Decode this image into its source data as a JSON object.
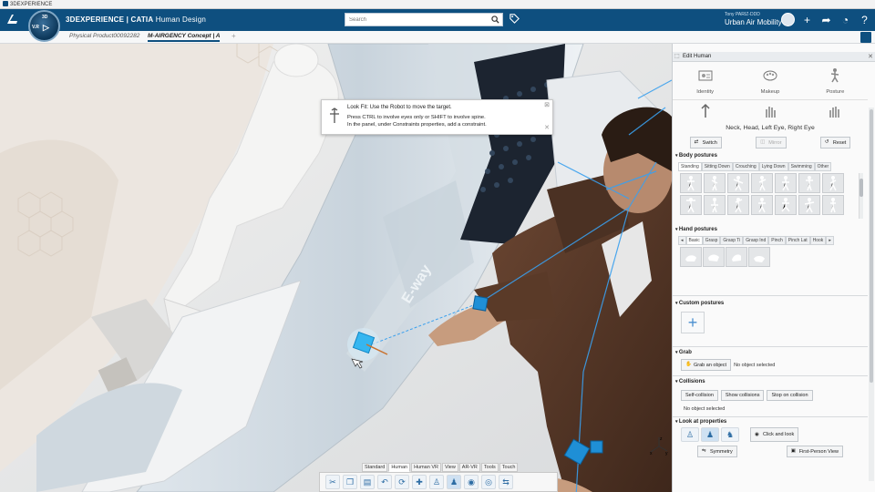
{
  "window": {
    "title": "3DEXPERIENCE"
  },
  "topbar": {
    "brand": "3DEXPERIENCE | CATIA",
    "app": "Human Design",
    "search_placeholder": "Search",
    "user": "Tony PARIZ-DDD",
    "context": "Urban Air Mobility"
  },
  "compass": {
    "top": "3D",
    "left": "V.R",
    "center": "▷"
  },
  "tabs": [
    {
      "label": "Physical Product00092282",
      "active": false
    },
    {
      "label": "M-AIRGENCY Concept | A",
      "active": true
    }
  ],
  "hint": {
    "title": "Look Fit: Use the Robot to move the target.",
    "line1": "Press CTRL to involve eyes only or SHIFT to involve spine.",
    "line2": "In the panel, under Constraints properties, add a constraint."
  },
  "viewport": {
    "tool_tabs": [
      "Standard",
      "Human",
      "Human VR",
      "View",
      "AR-VR",
      "Tools",
      "Touch"
    ],
    "active_tool_tab": "Human",
    "toolbar_icons": [
      "cut-icon",
      "copy-icon",
      "paste-icon",
      "undo-icon",
      "update-icon",
      "compass-icon",
      "pose-icon",
      "human-select-icon",
      "gaze-icon",
      "view-icon",
      "section-icon"
    ]
  },
  "panel": {
    "title": "Edit Human",
    "top_icons": [
      {
        "label": "Identity",
        "icon": "identity-icon"
      },
      {
        "label": "Makeup",
        "icon": "makeup-icon"
      },
      {
        "label": "Posture",
        "icon": "posture-icon"
      }
    ],
    "selection": "Neck, Head, Left Eye, Right Eye",
    "actions": {
      "switch": "Switch",
      "mirror": "Mirror",
      "reset": "Reset"
    },
    "body_postures": {
      "heading": "Body postures",
      "tabs": [
        "Standing",
        "Sitting Down",
        "Crouching",
        "Lying Down",
        "Swimming",
        "Other"
      ],
      "active_tab": "Standing"
    },
    "hand_postures": {
      "heading": "Hand postures",
      "tabs": [
        "Basic",
        "Grasp",
        "Grasp Ti",
        "Grasp Ind",
        "Pinch",
        "Pinch Lat",
        "Hook"
      ],
      "active_tab": "Basic"
    },
    "custom_postures": {
      "heading": "Custom postures"
    },
    "grab": {
      "heading": "Grab",
      "button": "Grab an object",
      "status": "No object selected"
    },
    "collisions": {
      "heading": "Collisions",
      "buttons": [
        "Self-collision",
        "Show collisions",
        "Stop on collision"
      ],
      "status": "No object selected"
    },
    "look_at": {
      "heading": "Look at properties",
      "button": "Click and look"
    },
    "bottom": {
      "symmetry": "Symmetry",
      "first_person": "First-Person View"
    }
  },
  "colors": {
    "brand": "#0e4f7f",
    "accent": "#2e6da4",
    "target": "#1f8fd6"
  }
}
